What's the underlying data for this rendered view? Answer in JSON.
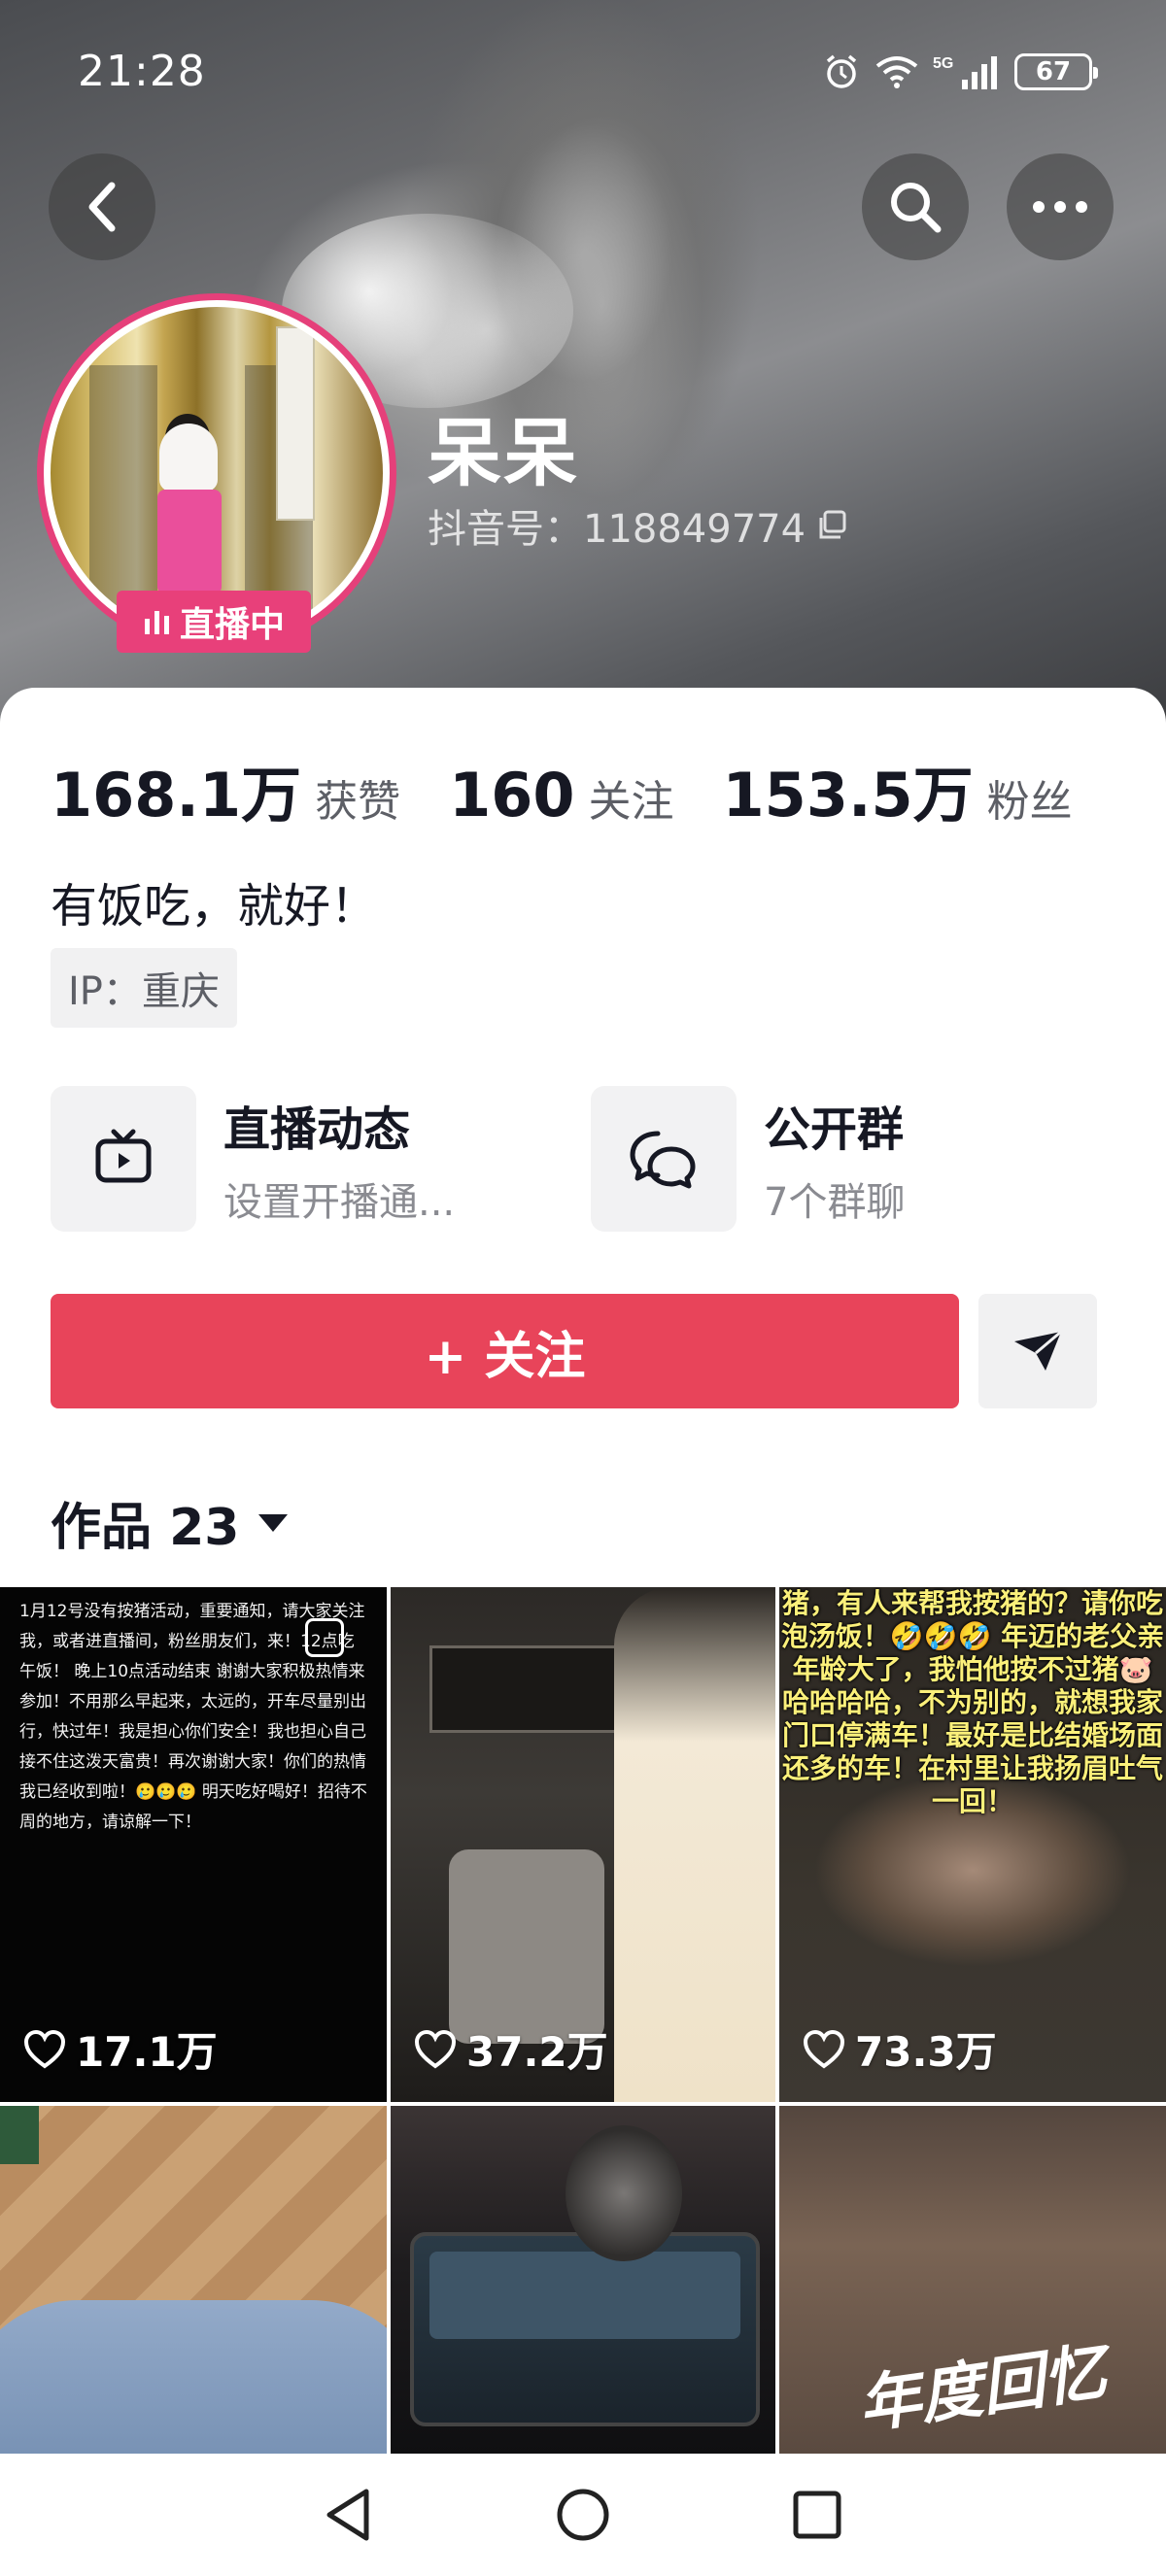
{
  "status": {
    "time": "21:28",
    "battery": "67"
  },
  "profile": {
    "name": "呆呆",
    "douyin_id": "抖音号：118849774",
    "live_badge": "直播中",
    "stats": [
      {
        "num": "168.1万",
        "label": "获赞"
      },
      {
        "num": "160",
        "label": "关注"
      },
      {
        "num": "153.5万",
        "label": "粉丝"
      }
    ],
    "bio": "有饭吃，就好！",
    "ip": "IP：重庆"
  },
  "features": [
    {
      "title": "直播动态",
      "sub": "设置开播通...",
      "icon": "tv-icon"
    },
    {
      "title": "公开群",
      "sub": "7个群聊",
      "icon": "chat-bubbles-icon"
    }
  ],
  "actions": {
    "follow": "+ 关注",
    "share_icon": "send-icon"
  },
  "works": {
    "label": "作品 23"
  },
  "tiles": [
    {
      "likes": "17.1万",
      "text": "1月12号没有按猪活动，重要通知，请大家关注我，或者进直播间，粉丝朋友们，来！12点吃午饭！ 晚上10点活动结束 谢谢大家积极热情来参加！不用那么早起来，太远的，开车尽量别出行，快过年！我是担心你们安全！我也担心自己接不住这泼天富贵！再次谢谢大家！你们的热情我已经收到啦！🥲🥲🥲  明天吃好喝好！招待不周的地方，请谅解一下！"
    },
    {
      "likes": "37.2万"
    },
    {
      "likes": "73.3万",
      "text": "猪，有人来帮我按猪的？请你吃泡汤饭！🤣🤣🤣 年迈的老父亲年龄大了，我怕他按不过猪🐷 哈哈哈哈，不为别的，就想我家门口停满车！最好是比结婚场面还多的车！在村里让我扬眉吐气一回！"
    },
    {
      "likes": ""
    },
    {
      "likes": ""
    },
    {
      "likes": "",
      "text": "年度回忆"
    }
  ],
  "colors": {
    "accent": "#e8445a",
    "live": "#e8407a"
  }
}
